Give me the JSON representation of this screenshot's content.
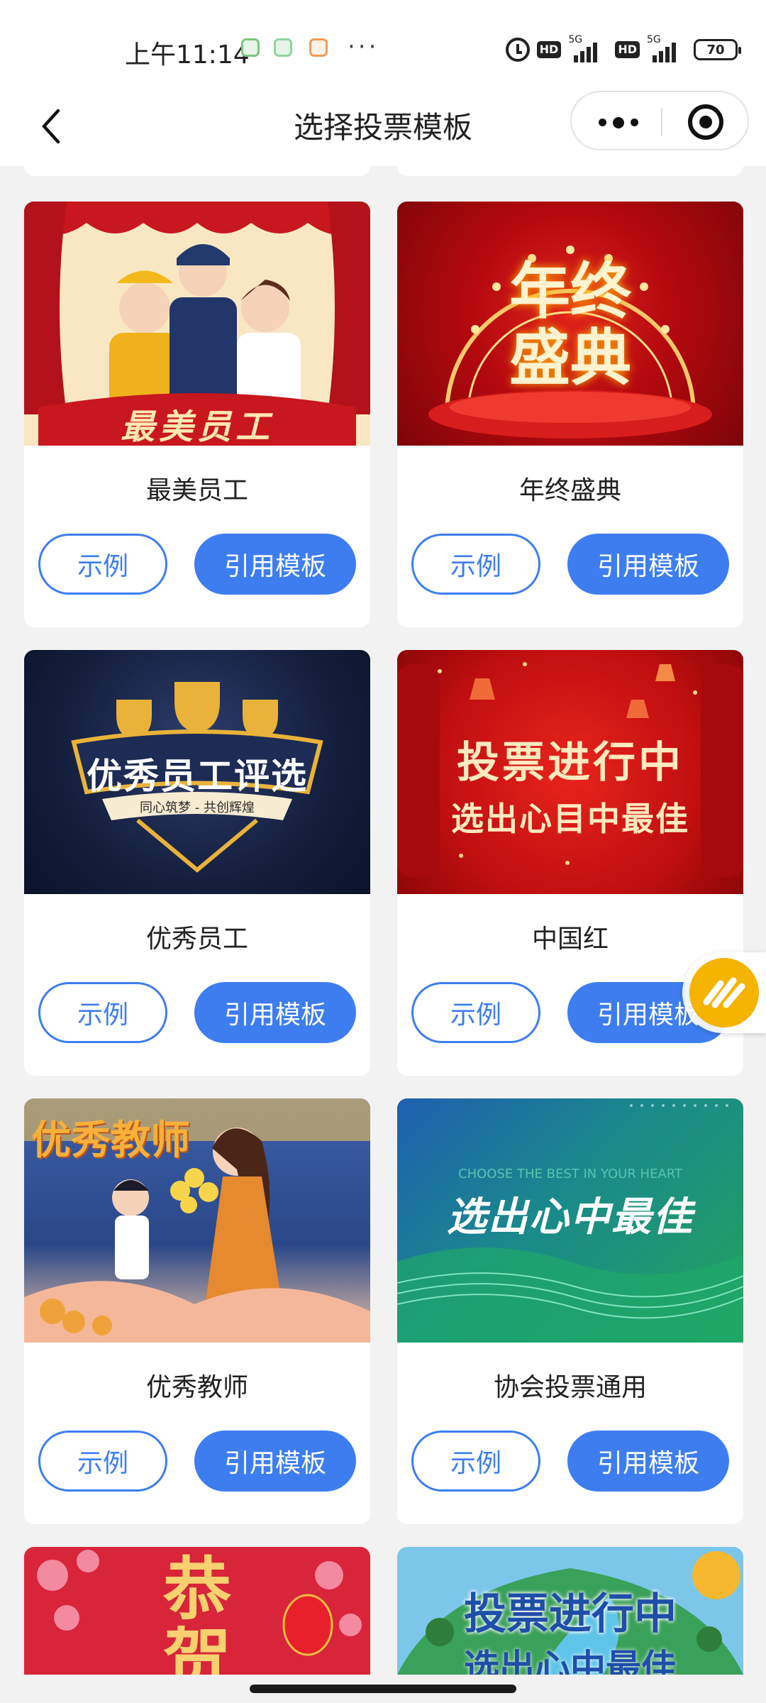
{
  "status": {
    "time": "上午11:14",
    "net1": "5G",
    "net2": "5G",
    "hd1": "HD",
    "hd2": "HD",
    "battery": "70"
  },
  "nav": {
    "title": "选择投票模板"
  },
  "templates": [
    {
      "name": "最美员工",
      "banner": "最美员工",
      "example": "示例",
      "use": "引用模板"
    },
    {
      "name": "年终盛典",
      "banner": "年终盛典",
      "example": "示例",
      "use": "引用模板"
    },
    {
      "name": "优秀员工",
      "banner": "优秀员工评选",
      "sub": "同心筑梦 - 共创辉煌",
      "example": "示例",
      "use": "引用模板"
    },
    {
      "name": "中国红",
      "banner": "投票进行中",
      "sub": "选出心目中最佳",
      "example": "示例",
      "use": "引用模板"
    },
    {
      "name": "优秀教师",
      "banner": "优秀教师",
      "example": "示例",
      "use": "引用模板"
    },
    {
      "name": "协会投票通用",
      "banner": "选出心中最佳",
      "sub": "CHOOSE THE BEST IN YOUR HEART",
      "example": "示例",
      "use": "引用模板"
    },
    {
      "banner": "恭贺"
    },
    {
      "banner": "投票进行中",
      "sub": "选出心中最佳"
    }
  ]
}
